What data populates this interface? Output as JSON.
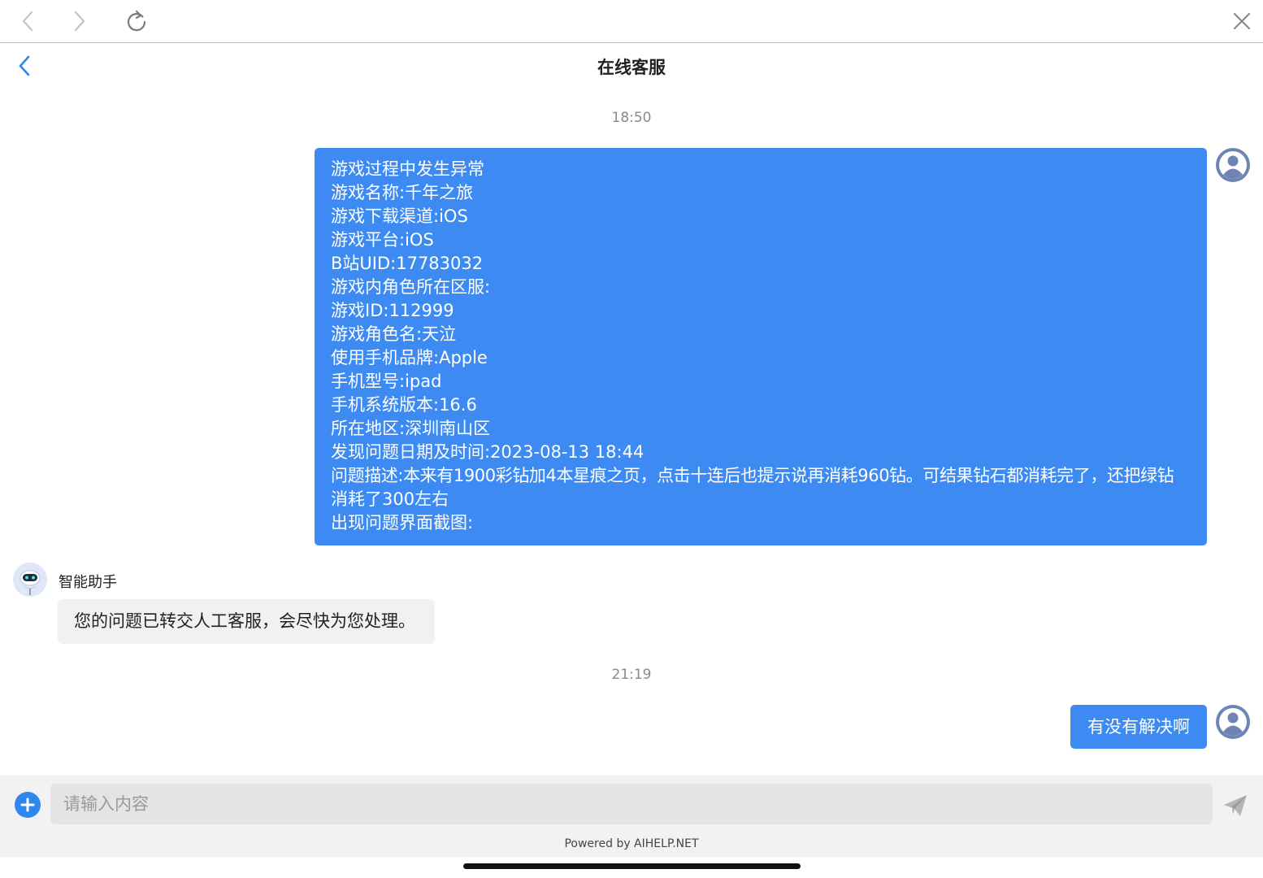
{
  "browser": {
    "back_icon": "chevron-left-icon",
    "forward_icon": "chevron-right-icon",
    "reload_icon": "reload-icon",
    "close_icon": "close-icon"
  },
  "header": {
    "title": "在线客服",
    "back_icon": "chevron-left-icon"
  },
  "messages": {
    "timestamp_1": "18:50",
    "user_message_1": {
      "lines": [
        "游戏过程中发生异常",
        "游戏名称:千年之旅",
        "游戏下载渠道:iOS",
        "游戏平台:iOS",
        "B站UID:17783032",
        "游戏内角色所在区服:",
        "游戏ID:112999",
        "游戏角色名:天泣",
        "使用手机品牌:Apple",
        "手机型号:ipad",
        "手机系统版本:16.6",
        "所在地区:深圳南山区",
        "发现问题日期及时间:2023-08-13 18:44",
        "问题描述:本来有1900彩钻加4本星痕之页，点击十连后也提示说再消耗960钻。可结果钻石都消耗完了，还把绿钻",
        "消耗了300左右",
        "出现问题界面截图:"
      ]
    },
    "agent": {
      "name": "智能助手",
      "text": "您的问题已转交人工客服，会尽快为您处理。"
    },
    "timestamp_2": "21:19",
    "user_message_2": "有没有解决啊"
  },
  "input": {
    "placeholder": "请输入内容",
    "value": ""
  },
  "footer": {
    "powered_by": "Powered by AIHELP.NET"
  },
  "colors": {
    "user_bubble": "#3d8bf2",
    "agent_bubble": "#f1f1f1",
    "accent": "#2f86ec"
  }
}
